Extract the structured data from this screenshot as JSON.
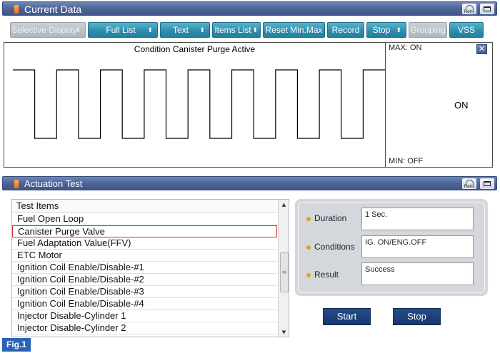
{
  "current_data": {
    "title": "Current Data",
    "retry_label": "Retry",
    "toolbar": {
      "selective_display": "Selective Display",
      "full_list": "Full List",
      "text": "Text",
      "items_list": "Items List",
      "reset_min_max": "Reset Min.Max",
      "record": "Record",
      "stop": "Stop",
      "grouping": "Grouping",
      "vss": "VSS"
    },
    "graph": {
      "title": "Condition Canister Purge Active",
      "max_label": "MAX: ON",
      "min_label": "MIN: OFF",
      "current_value": "ON",
      "close_glyph": "✕",
      "signal": {
        "type": "square-wave",
        "levels": [
          "OFF",
          "ON"
        ],
        "values": [
          1,
          0,
          1,
          0,
          1,
          0,
          1,
          0,
          1,
          0,
          1,
          0,
          1,
          0,
          1,
          0,
          1
        ]
      }
    }
  },
  "actuation_test": {
    "title": "Actuation Test",
    "retry_label": "Retry",
    "list_header": "Test Items",
    "items": [
      "Fuel Open Loop",
      "Canister Purge Valve",
      "Fuel Adaptation Value(FFV)",
      "ETC Motor",
      "Ignition Coil Enable/Disable-#1",
      "Ignition Coil Enable/Disable-#2",
      "Ignition Coil Enable/Disable-#3",
      "Ignition Coil Enable/Disable-#4",
      "Injector Disable-Cylinder 1",
      "Injector Disable-Cylinder 2"
    ],
    "selected_index": 1,
    "fields": {
      "duration_label": "Duration",
      "duration_value": "1 Sec.",
      "conditions_label": "Conditions",
      "conditions_value": "IG. ON/ENG.OFF",
      "result_label": "Result",
      "result_value": "Success"
    },
    "start_label": "Start",
    "stop_label": "Stop"
  },
  "figure_label": "Fig.1",
  "colors": {
    "header_blue": "#4a6296",
    "toolbar_teal": "#2f8eae",
    "accent_orange": "#f39b1d",
    "selection_red": "#cc3333",
    "button_navy": "#163770",
    "figure_blue": "#2a63b5"
  }
}
